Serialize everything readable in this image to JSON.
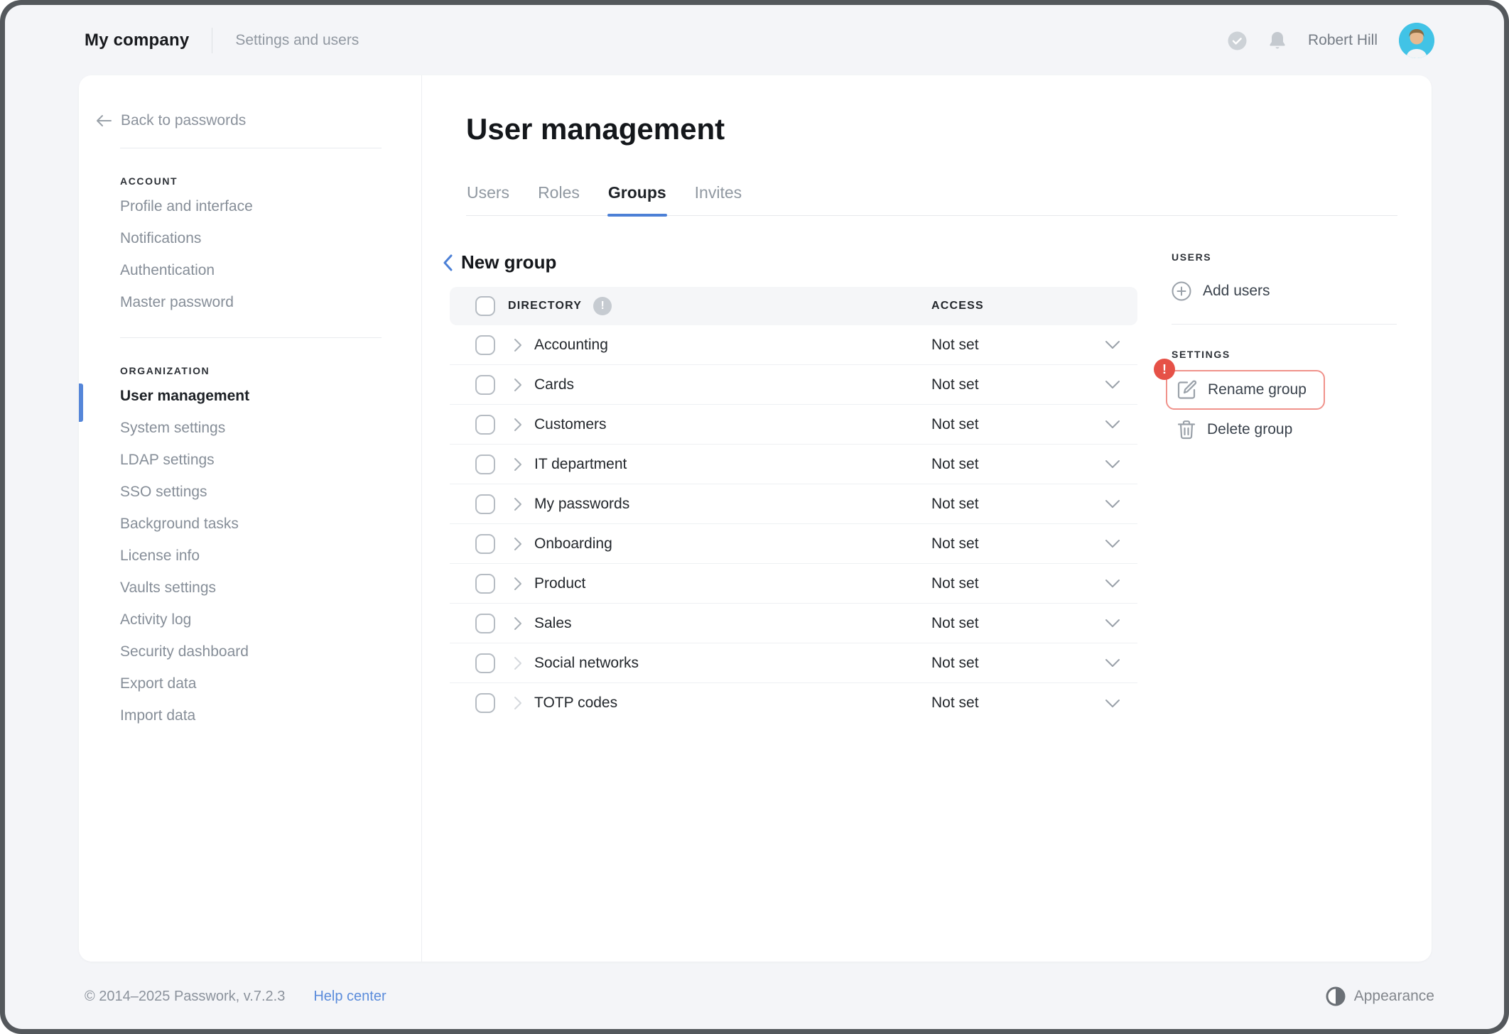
{
  "topbar": {
    "company": "My company",
    "section": "Settings and users",
    "user_name": "Robert Hill"
  },
  "sidebar": {
    "back": "Back to passwords",
    "sections": [
      {
        "title": "ACCOUNT",
        "items": [
          {
            "label": "Profile and interface"
          },
          {
            "label": "Notifications"
          },
          {
            "label": "Authentication"
          },
          {
            "label": "Master password"
          }
        ]
      },
      {
        "title": "ORGANIZATION",
        "items": [
          {
            "label": "User management",
            "active": true
          },
          {
            "label": "System settings"
          },
          {
            "label": "LDAP settings"
          },
          {
            "label": "SSO settings"
          },
          {
            "label": "Background tasks"
          },
          {
            "label": "License info"
          },
          {
            "label": "Vaults settings"
          },
          {
            "label": "Activity log"
          },
          {
            "label": "Security dashboard"
          },
          {
            "label": "Export data"
          },
          {
            "label": "Import data"
          }
        ]
      }
    ]
  },
  "main": {
    "title": "User management",
    "tabs": [
      {
        "label": "Users"
      },
      {
        "label": "Roles"
      },
      {
        "label": "Groups",
        "active": true
      },
      {
        "label": "Invites"
      }
    ],
    "group_title": "New group",
    "table": {
      "directory_header": "DIRECTORY",
      "access_header": "ACCESS",
      "info_glyph": "!",
      "rows": [
        {
          "name": "Accounting",
          "access": "Not set"
        },
        {
          "name": "Cards",
          "access": "Not set"
        },
        {
          "name": "Customers",
          "access": "Not set"
        },
        {
          "name": "IT department",
          "access": "Not set"
        },
        {
          "name": "My passwords",
          "access": "Not set"
        },
        {
          "name": "Onboarding",
          "access": "Not set"
        },
        {
          "name": "Product",
          "access": "Not set"
        },
        {
          "name": "Sales",
          "access": "Not set"
        },
        {
          "name": "Social networks",
          "access": "Not set",
          "muted_chevron": true
        },
        {
          "name": "TOTP codes",
          "access": "Not set",
          "muted_chevron": true
        }
      ]
    }
  },
  "panel": {
    "users_title": "USERS",
    "add_users": "Add users",
    "settings_title": "SETTINGS",
    "rename": "Rename group",
    "delete": "Delete group",
    "alert_glyph": "!"
  },
  "footer": {
    "copyright": "© 2014–2025 Passwork, v.7.2.3",
    "help": "Help center",
    "appearance": "Appearance"
  },
  "colors": {
    "accent_blue": "#4c80d6",
    "alert_red": "#e65147",
    "highlight_border": "#f0928b",
    "avatar_bg": "#41c3e6",
    "page_bg": "#f4f5f8"
  }
}
